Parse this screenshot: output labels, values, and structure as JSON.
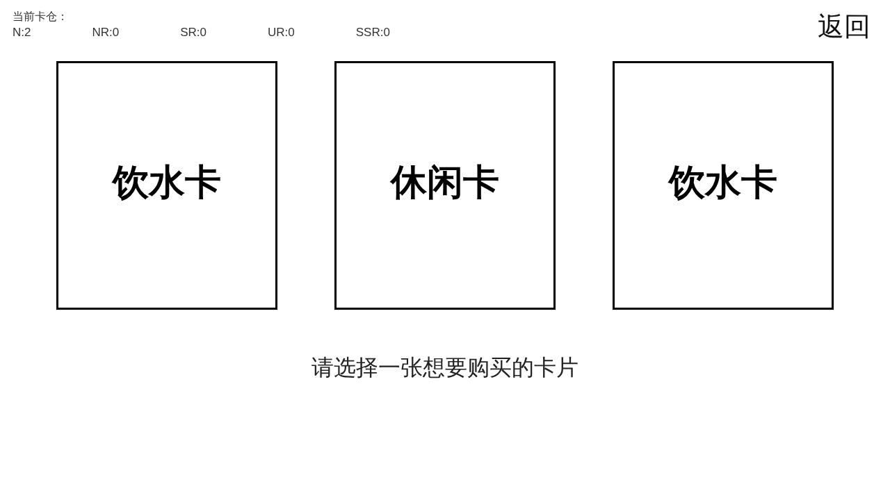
{
  "inventory": {
    "title": "当前卡仓：",
    "counts": [
      "N:2",
      "NR:0",
      "SR:0",
      "UR:0",
      "SSR:0"
    ]
  },
  "back_button": "返回",
  "cards": [
    {
      "label": "饮水卡"
    },
    {
      "label": "休闲卡"
    },
    {
      "label": "饮水卡"
    }
  ],
  "prompt": "请选择一张想要购买的卡片"
}
